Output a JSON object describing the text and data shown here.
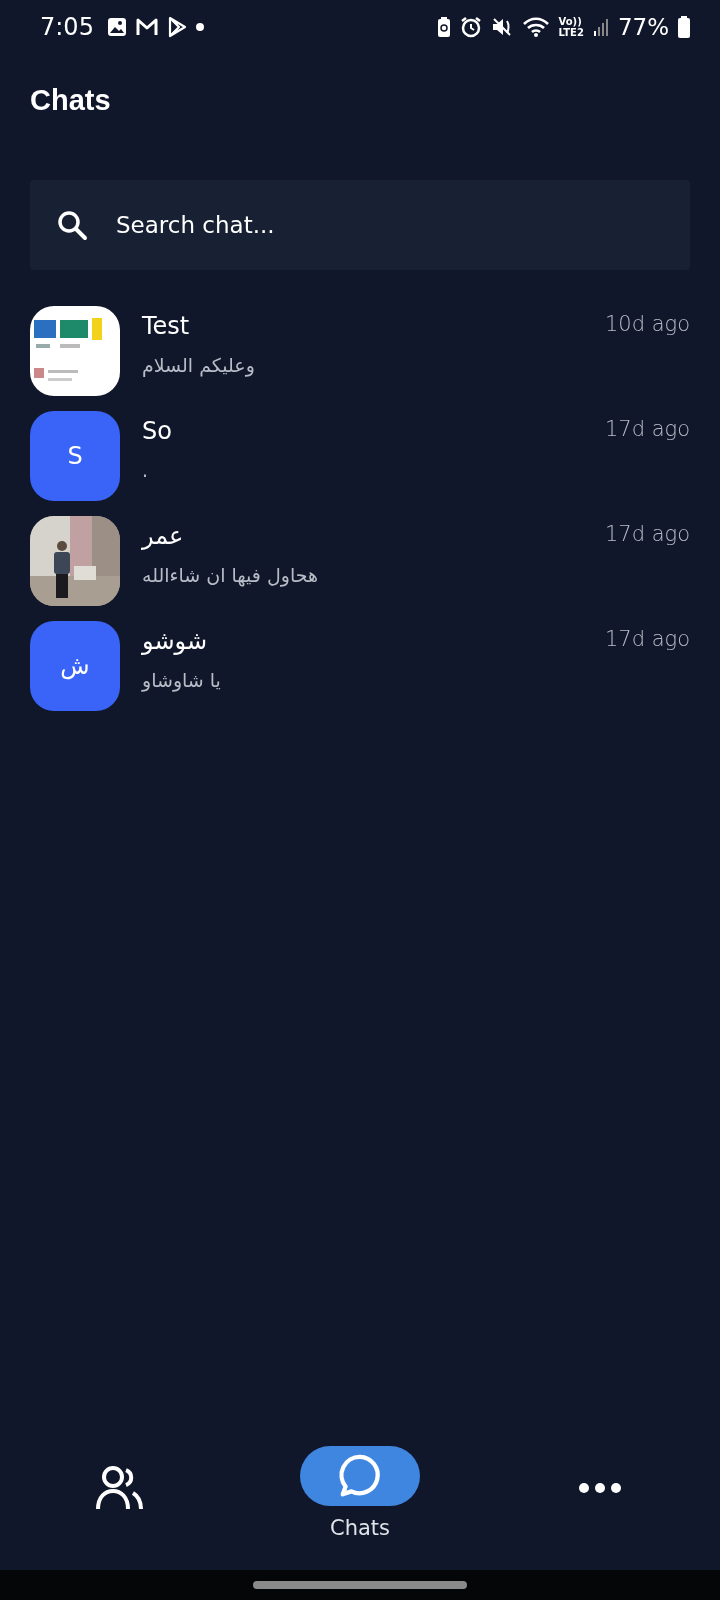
{
  "status_bar": {
    "time": "7:05",
    "network": [
      "Vo))",
      "LTE2"
    ],
    "battery": "77%"
  },
  "header": {
    "title": "Chats"
  },
  "search": {
    "placeholder": "Search chat..."
  },
  "chats": [
    {
      "name": "Test",
      "preview": "وعليكم السلام",
      "time": "10d ago"
    },
    {
      "name": "So",
      "preview": ".",
      "time": "17d ago",
      "avatar": {
        "kind": "letter",
        "letter": "S"
      }
    },
    {
      "name": "عمر",
      "preview": "هحاول فيها  ان شاءالله",
      "time": "17d ago"
    },
    {
      "name": "شوشو",
      "preview": "يا شاوشاو",
      "time": "17d ago",
      "avatar": {
        "kind": "letter",
        "letter": "ش"
      }
    }
  ],
  "nav": [
    {
      "kind": "contacts",
      "selected": false
    },
    {
      "kind": "chats",
      "label": "Chats",
      "selected": true
    },
    {
      "kind": "more",
      "selected": false
    }
  ]
}
